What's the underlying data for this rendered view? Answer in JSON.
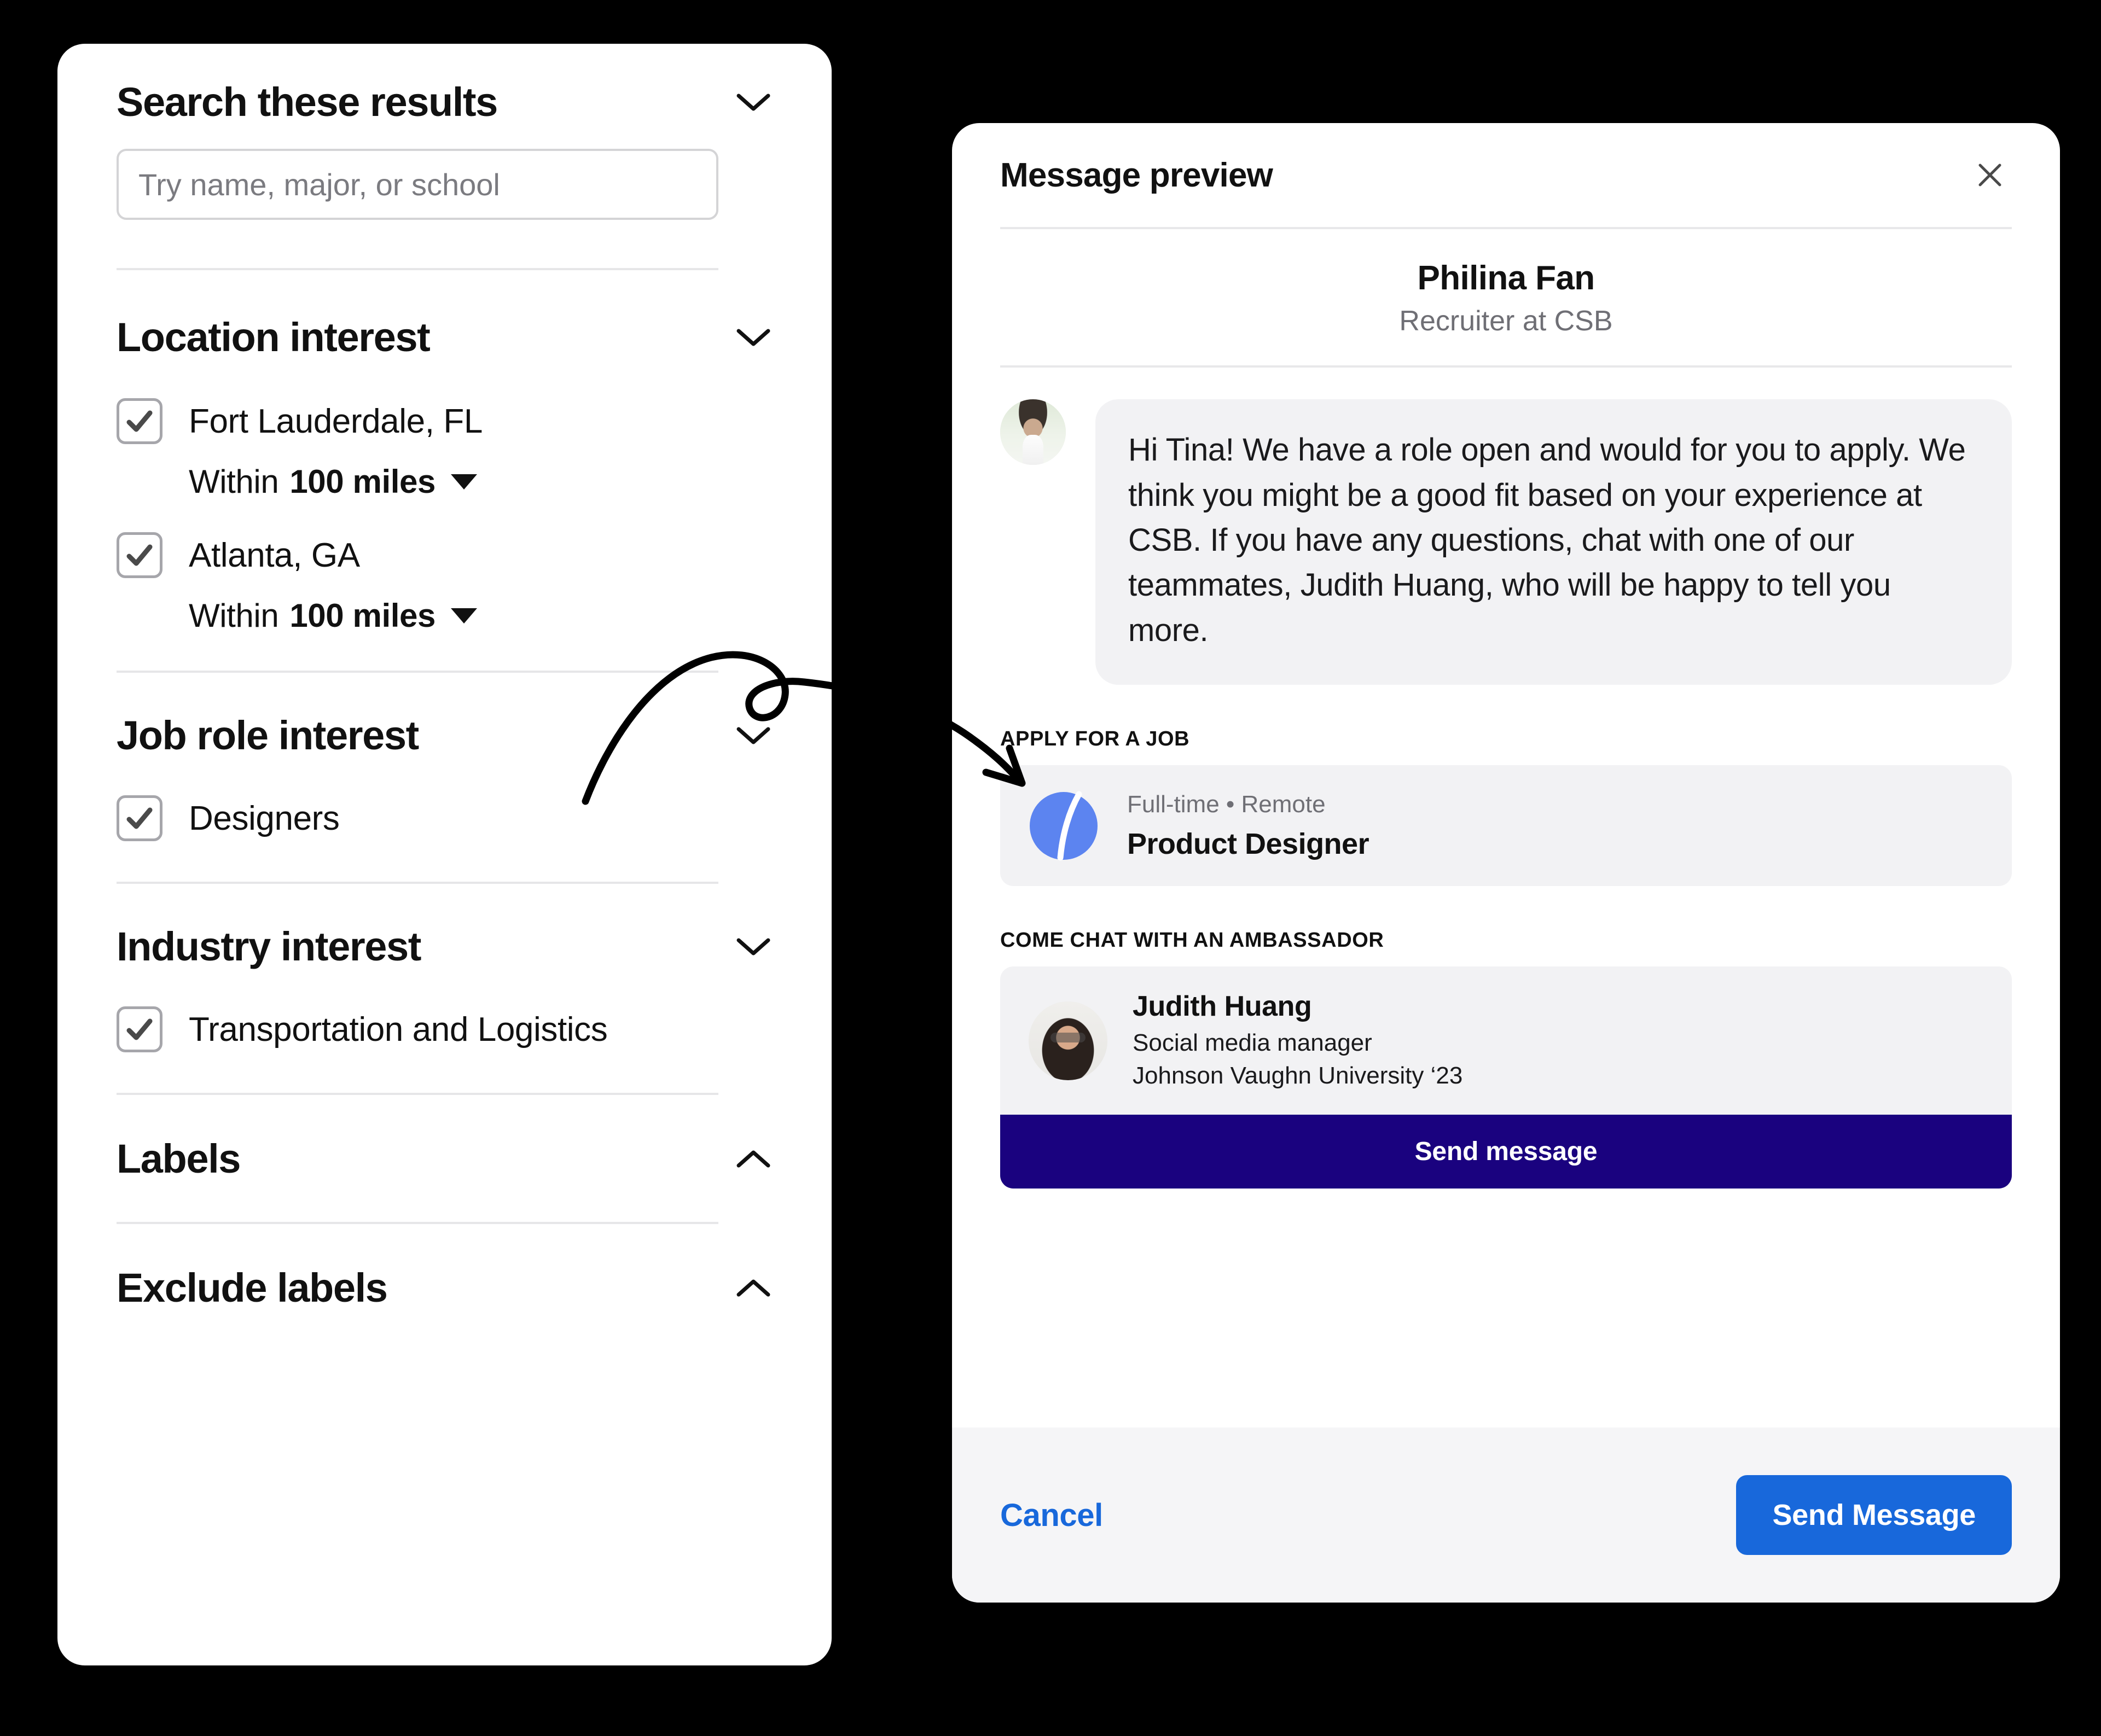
{
  "filters": {
    "search_section": {
      "title": "Search these results",
      "chevron": "chevron-down-icon",
      "input_placeholder": "Try name, major, or school",
      "input_value": ""
    },
    "location_section": {
      "title": "Location interest",
      "chevron": "chevron-down-icon",
      "options": [
        {
          "label": "Fort Lauderdale, FL",
          "checked": true,
          "radius_lead": "Within",
          "radius_value": "100 miles"
        },
        {
          "label": "Atlanta, GA",
          "checked": true,
          "radius_lead": "Within",
          "radius_value": "100 miles"
        }
      ]
    },
    "job_role_section": {
      "title": "Job role interest",
      "chevron": "chevron-down-icon",
      "options": [
        {
          "label": "Designers",
          "checked": true
        }
      ]
    },
    "industry_section": {
      "title": "Industry interest",
      "chevron": "chevron-down-icon",
      "options": [
        {
          "label": "Transportation and Logistics",
          "checked": true
        }
      ]
    },
    "labels_section": {
      "title": "Labels",
      "chevron": "chevron-up-icon"
    },
    "exclude_labels_section": {
      "title": "Exclude labels",
      "chevron": "chevron-up-icon"
    }
  },
  "message_preview": {
    "title": "Message preview",
    "close_icon": "close-icon",
    "sender": {
      "name": "Philina Fan",
      "role": "Recruiter at CSB",
      "avatar": "recruiter-avatar"
    },
    "bubble_text": "Hi Tina! We have a role open and would for you to apply. We think you might be a good fit based on your experience at CSB. If you have any questions, chat with one of our teammates, Judith Huang, who will be happy to tell you more.",
    "job_section": {
      "caption": "APPLY FOR A JOB",
      "logo": "company-logo-j",
      "meta": "Full-time • Remote",
      "title": "Product Designer"
    },
    "ambassador_section": {
      "caption": "COME CHAT WITH AN AMBASSADOR",
      "avatar": "ambassador-avatar",
      "name": "Judith Huang",
      "role": "Social media manager",
      "school": "Johnson Vaughn University ‘23",
      "button_label": "Send message"
    },
    "footer": {
      "cancel_label": "Cancel",
      "send_label": "Send Message"
    }
  },
  "annotation": {
    "shape": "curved-arrow"
  },
  "colors": {
    "background": "#000000",
    "panel": "#ffffff",
    "card_gray": "#f2f2f4",
    "footer_gray": "#f5f5f7",
    "accent_blue": "#1868DB",
    "accent_indigo": "#1A027F",
    "logo_blue": "#5C84F0",
    "muted_text": "#6f6f75",
    "border": "#e6e6e8"
  }
}
